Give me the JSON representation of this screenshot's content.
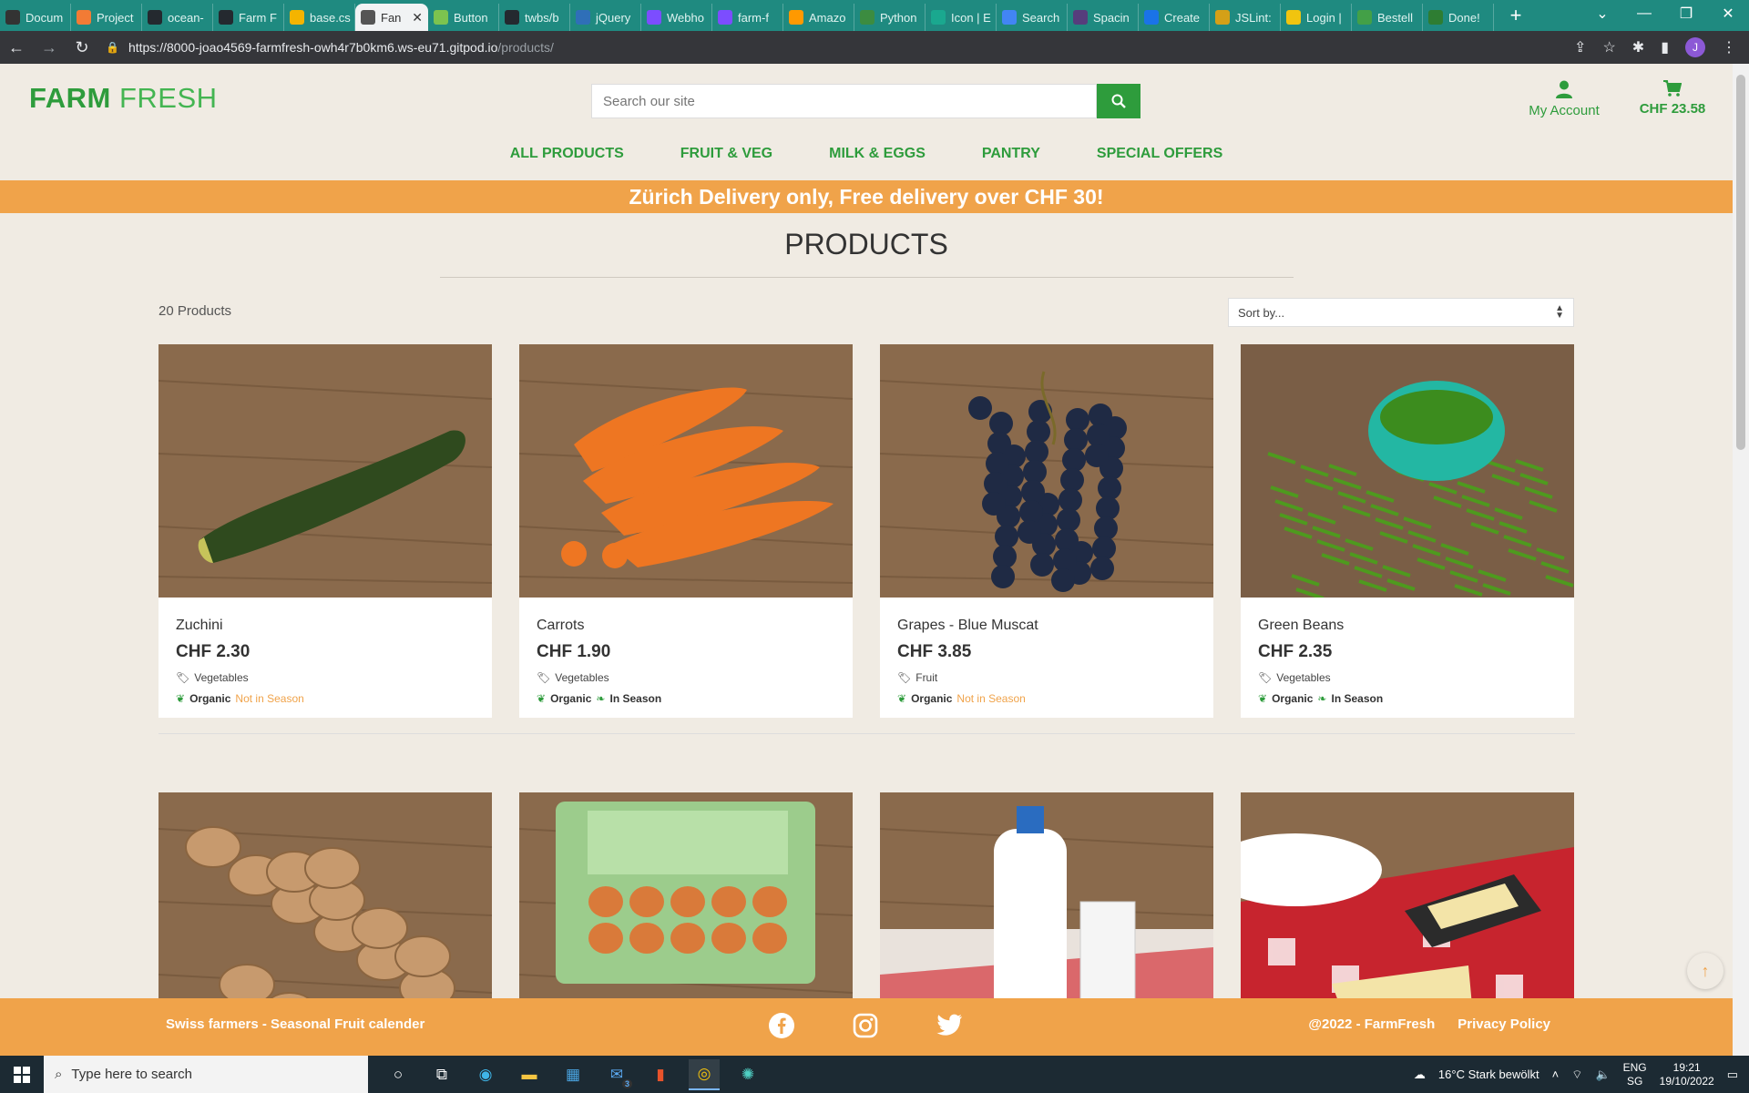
{
  "browser": {
    "tabs": [
      {
        "label": "Docum",
        "color": "#333333"
      },
      {
        "label": "Project",
        "color": "#f27b35"
      },
      {
        "label": "ocean-",
        "color": "#24292f"
      },
      {
        "label": "Farm F",
        "color": "#24292f"
      },
      {
        "label": "base.cs",
        "color": "#f4b400"
      },
      {
        "label": "Fan",
        "color": "#ffffff",
        "active": true
      },
      {
        "label": "Button",
        "color": "#7cc34f"
      },
      {
        "label": "twbs/b",
        "color": "#24292f"
      },
      {
        "label": "jQuery",
        "color": "#2f6fb8"
      },
      {
        "label": "Webho",
        "color": "#7c4dff"
      },
      {
        "label": "farm-f",
        "color": "#7c4dff"
      },
      {
        "label": "Amazo",
        "color": "#ff9900"
      },
      {
        "label": "Python",
        "color": "#3c8c40"
      },
      {
        "label": "Icon | E",
        "color": "#1aa88f"
      },
      {
        "label": "Search",
        "color": "#4285f4"
      },
      {
        "label": "Spacin",
        "color": "#563d7c"
      },
      {
        "label": "Create",
        "color": "#1a73e8"
      },
      {
        "label": "JSLint:",
        "color": "#d4a017"
      },
      {
        "label": "Login |",
        "color": "#f1c40f"
      },
      {
        "label": "Bestell",
        "color": "#43a047"
      },
      {
        "label": "Done!",
        "color": "#2e7d32"
      }
    ],
    "url_host": "https://8000-joao4569-farmfresh-owh4r7b0km6.ws-eu71.gitpod.io",
    "url_path": "/products/",
    "profile_initial": "J"
  },
  "header": {
    "brand_bold": "FARM",
    "brand_light": "FRESH",
    "search_placeholder": "Search our site",
    "account_label": "My Account",
    "bag_total": "CHF 23.58"
  },
  "nav": [
    "ALL PRODUCTS",
    "FRUIT & VEG",
    "MILK & EGGS",
    "PANTRY",
    "SPECIAL OFFERS"
  ],
  "banner": "Zürich Delivery only, Free delivery over CHF 30!",
  "page": {
    "title": "PRODUCTS",
    "count": "20 Products",
    "sort_label": "Sort by..."
  },
  "products": [
    {
      "name": "Zuchini",
      "price": "CHF 2.30",
      "category": "Vegetables",
      "organic": "Organic",
      "season": "Not in Season",
      "in_season": false,
      "image": "zucchini"
    },
    {
      "name": "Carrots",
      "price": "CHF 1.90",
      "category": "Vegetables",
      "organic": "Organic",
      "season": "In Season",
      "in_season": true,
      "image": "carrots"
    },
    {
      "name": "Grapes - Blue Muscat",
      "price": "CHF 3.85",
      "category": "Fruit",
      "organic": "Organic",
      "season": "Not in Season",
      "in_season": false,
      "image": "grapes"
    },
    {
      "name": "Green Beans",
      "price": "CHF 2.35",
      "category": "Vegetables",
      "organic": "Organic",
      "season": "In Season",
      "in_season": true,
      "image": "beans"
    }
  ],
  "products_row2": [
    {
      "image": "mushrooms"
    },
    {
      "image": "eggs"
    },
    {
      "image": "milk"
    },
    {
      "image": "raclette"
    }
  ],
  "footer": {
    "left": "Swiss farmers - Seasonal Fruit calender",
    "copyright": "@2022 - FarmFresh",
    "privacy": "Privacy Policy",
    "social": [
      "facebook-icon",
      "instagram-icon",
      "twitter-icon"
    ]
  },
  "taskbar": {
    "search_placeholder": "Type here to search",
    "weather": "16°C  Stark bewölkt",
    "lang": "ENG",
    "region": "SG",
    "time": "19:21",
    "date": "19/10/2022",
    "mail_badge": "3"
  },
  "colors": {
    "brand_green": "#2e9c3c",
    "accent_orange": "#f0a34a",
    "page_bg": "#f0ebe3"
  }
}
